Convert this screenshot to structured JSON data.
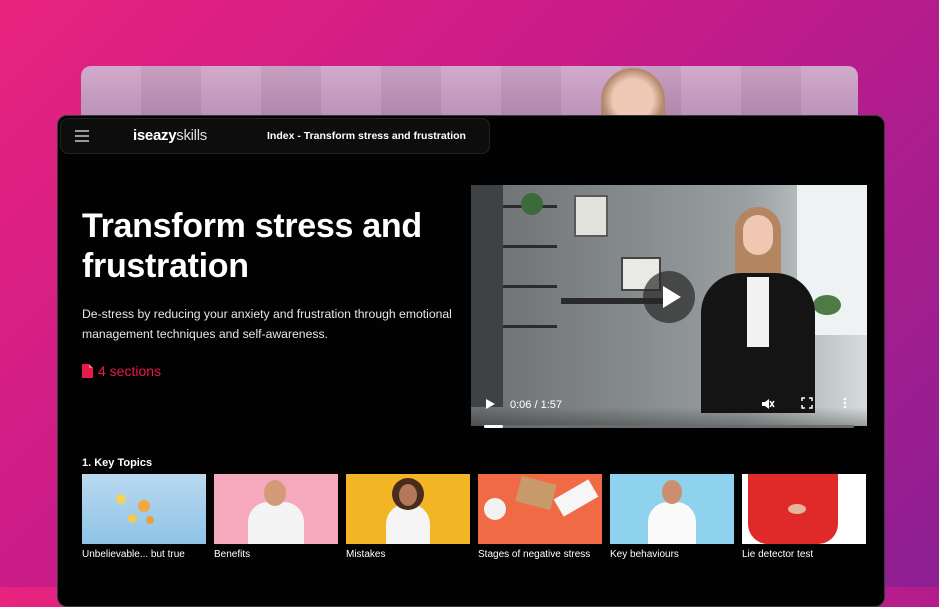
{
  "app": {
    "logo_bold": "iseazy",
    "logo_light": "skills",
    "breadcrumb": "Index - Transform stress and frustration"
  },
  "course": {
    "title": "Transform stress and frustration",
    "description": "De-stress by reducing your anxiety and frustration through emotional management techniques and self-awareness.",
    "sections_label": "4 sections"
  },
  "video": {
    "time": "0:06 / 1:57",
    "progress": 0.05
  },
  "topics": {
    "heading": "1. Key Topics",
    "items": [
      {
        "label": "Unbelievable... but true"
      },
      {
        "label": "Benefits"
      },
      {
        "label": "Mistakes"
      },
      {
        "label": "Stages of negative stress"
      },
      {
        "label": "Key behaviours"
      },
      {
        "label": "Lie detector test"
      }
    ]
  },
  "colors": {
    "accent": "#e8194b",
    "gradient_start": "#e8237e",
    "gradient_end": "#8c1f92"
  },
  "icons": {
    "menu": "hamburger-icon",
    "sections": "document-icon",
    "play": "play-icon",
    "mute": "volume-muted-icon",
    "fullscreen": "fullscreen-icon",
    "more": "more-vertical-icon"
  }
}
